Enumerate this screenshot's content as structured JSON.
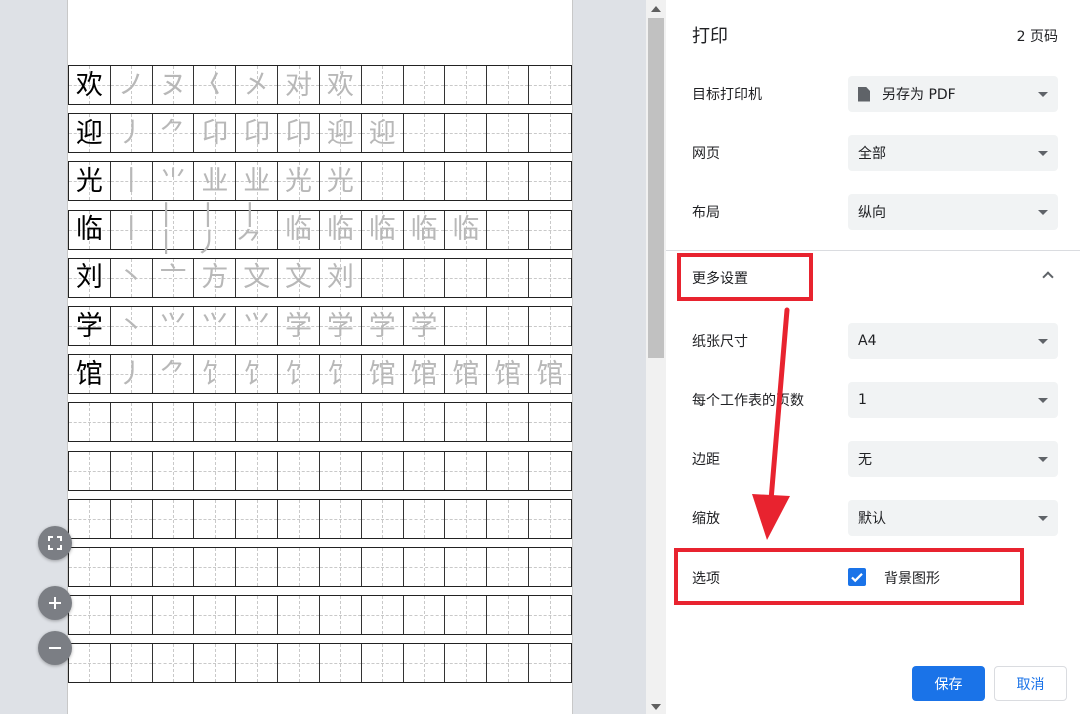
{
  "preview": {
    "rows": [
      {
        "model": "欢",
        "traces": [
          "ノ",
          "ヌ",
          "𡿨",
          "㐅",
          "对",
          "欢"
        ]
      },
      {
        "model": "迎",
        "traces": [
          "丿",
          "⺈",
          "卬",
          "卬",
          "卬",
          "迎",
          "迎"
        ]
      },
      {
        "model": "光",
        "traces": [
          "丨",
          "⺌",
          "业",
          "业",
          "光",
          "光"
        ]
      },
      {
        "model": "临",
        "traces": [
          "丨",
          "丨丨",
          "丨丿",
          "丨⺈",
          "临",
          "临",
          "临",
          "临",
          "临"
        ]
      },
      {
        "model": "刘",
        "traces": [
          "丶",
          "亠",
          "方",
          "文",
          "文",
          "刘"
        ]
      },
      {
        "model": "学",
        "traces": [
          "丶",
          "⺍",
          "⺍",
          "⺍",
          "学",
          "学",
          "学",
          "学"
        ]
      },
      {
        "model": "馆",
        "traces": [
          "丿",
          "⺈",
          "饣",
          "饣",
          "饣",
          "饣",
          "馆",
          "馆",
          "馆",
          "馆",
          "馆"
        ]
      }
    ],
    "empty_row_count": 6
  },
  "panel": {
    "title": "打印",
    "page_count": "2 页码",
    "destination": {
      "label": "目标打印机",
      "value": "另存为 PDF"
    },
    "pages": {
      "label": "网页",
      "value": "全部"
    },
    "layout": {
      "label": "布局",
      "value": "纵向"
    },
    "more_settings": "更多设置",
    "paper_size": {
      "label": "纸张尺寸",
      "value": "A4"
    },
    "pages_per_sheet": {
      "label": "每个工作表的页数",
      "value": "1"
    },
    "margins": {
      "label": "边距",
      "value": "无"
    },
    "scale": {
      "label": "缩放",
      "value": "默认"
    },
    "options": {
      "label": "选项",
      "checkbox_label": "背景图形",
      "checked": true
    },
    "save_label": "保存",
    "cancel_label": "取消"
  },
  "colors": {
    "accent": "#1a73e8",
    "annotation": "#e8232f"
  }
}
